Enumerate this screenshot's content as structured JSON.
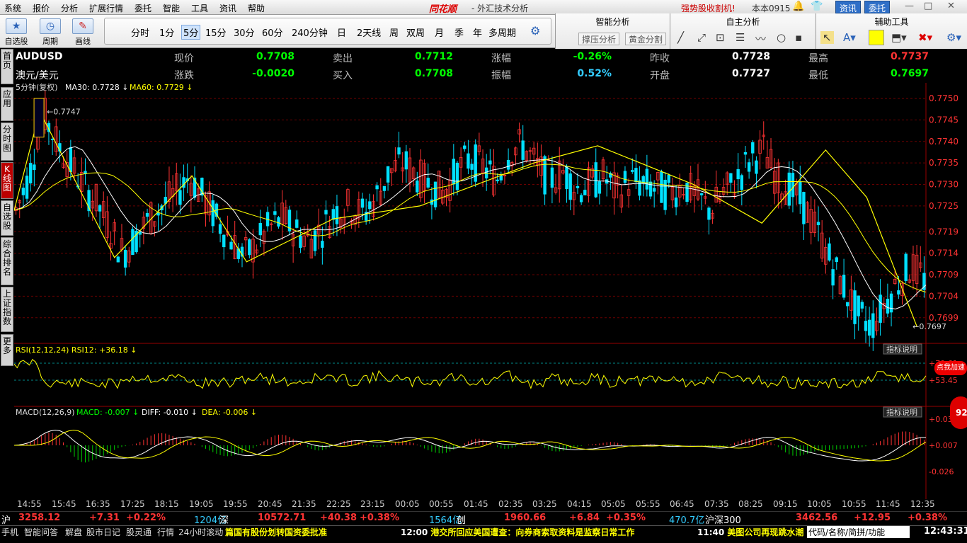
{
  "menu": {
    "items": [
      "系统",
      "报价",
      "分析",
      "扩展行情",
      "委托",
      "智能",
      "工具",
      "资讯",
      "帮助"
    ],
    "brand": "同花顺",
    "subtitle": "- 外汇技术分析",
    "promo": "强势股收割机!",
    "version": "本本0915",
    "btn_news": "资讯",
    "btn_trade": "委托",
    "win_min": "—",
    "win_max": "□",
    "win_close": "✕"
  },
  "toolbar": {
    "select_stock": "自选股",
    "period": "周期",
    "draw": "画线",
    "periods": [
      "分时",
      "1分",
      "5分",
      "15分",
      "30分",
      "60分",
      "240分钟",
      "日",
      "2天线",
      "周",
      "双周",
      "月",
      "季",
      "年",
      "多周期"
    ],
    "selected_period": "5分",
    "smart": {
      "title": "智能分析",
      "btn1": "撑压分析",
      "btn2": "黄金分割"
    },
    "custom": {
      "title": "自主分析"
    },
    "aux": {
      "title": "辅助工具"
    }
  },
  "lefttabs": [
    "首页",
    "应用",
    "分时图",
    "K线图",
    "自选股",
    "综合排名",
    "上证指数",
    "更多"
  ],
  "info": {
    "symbol": "AUDUSD",
    "name": "澳元/美元",
    "row1": [
      [
        "现价",
        "0.7708",
        "g"
      ],
      [
        "卖出",
        "0.7712",
        "g"
      ],
      [
        "涨幅",
        "-0.26%",
        "g"
      ],
      [
        "昨收",
        "0.7728",
        "w"
      ],
      [
        "最高",
        "0.7737",
        "r"
      ]
    ],
    "row2": [
      [
        "涨跌",
        "-0.0020",
        "g"
      ],
      [
        "买入",
        "0.7708",
        "g"
      ],
      [
        "振幅",
        "0.52%",
        "c"
      ],
      [
        "开盘",
        "0.7727",
        "w"
      ],
      [
        "最低",
        "0.7697",
        "g"
      ]
    ]
  },
  "chart_data": {
    "type": "candlestick",
    "title": "5分钟(复权)",
    "ma30": "MA30: 0.7728",
    "ma60": "MA60: 0.7729",
    "y_ticks": [
      "0.7750",
      "0.7745",
      "0.7740",
      "0.7735",
      "0.7730",
      "0.7725",
      "0.7719",
      "0.7714",
      "0.7709",
      "0.7704",
      "0.7699"
    ],
    "y_range": [
      0.7696,
      0.7751
    ],
    "high_label": "0.7747",
    "low_label": "0.7697",
    "rsi": {
      "label": "RSI(12,12,24) RSI12: +36.18",
      "ticks": [
        "79.61",
        "53.45"
      ],
      "button": "指标说明"
    },
    "macd": {
      "label": "MACD(12,26,9)",
      "macd": "MACD: -0.007",
      "diff": "DIFF: -0.010",
      "dea": "DEA: -0.006",
      "ticks": [
        "0.038",
        "0.007",
        "-0.026"
      ],
      "button": "指标说明"
    },
    "x_ticks": [
      "14:55",
      "15:45",
      "16:35",
      "17:25",
      "18:15",
      "19:05",
      "19:55",
      "20:45",
      "21:35",
      "22:25",
      "23:15",
      "00:05",
      "00:55",
      "01:45",
      "02:35",
      "03:25",
      "04:15",
      "05:05",
      "05:55",
      "06:45",
      "07:35",
      "08:25",
      "09:15",
      "10:05",
      "10:55",
      "11:45",
      "12:35"
    ],
    "close_path": [
      0.7724,
      0.7732,
      0.7747,
      0.774,
      0.7735,
      0.773,
      0.7726,
      0.772,
      0.7714,
      0.7718,
      0.7722,
      0.7725,
      0.7728,
      0.7732,
      0.7727,
      0.7722,
      0.7718,
      0.7713,
      0.7716,
      0.772,
      0.7722,
      0.7719,
      0.7717,
      0.772,
      0.7724,
      0.7725,
      0.7723,
      0.7727,
      0.7733,
      0.7735,
      0.7732,
      0.773,
      0.7728,
      0.7733,
      0.7736,
      0.7734,
      0.7731,
      0.7738,
      0.7739,
      0.7734,
      0.7731,
      0.7733,
      0.7729,
      0.773,
      0.7732,
      0.7728,
      0.7731,
      0.773,
      0.7729,
      0.7728,
      0.773,
      0.7727,
      0.7724,
      0.7728,
      0.7731,
      0.7736,
      0.7738,
      0.7731,
      0.7729,
      0.7725,
      0.7719,
      0.7712,
      0.7706,
      0.77,
      0.7697,
      0.7702,
      0.7707,
      0.7711,
      0.7708
    ],
    "zigzag": [
      [
        0.0,
        0.7724
      ],
      [
        0.028,
        0.7747
      ],
      [
        0.11,
        0.7713
      ],
      [
        0.195,
        0.7732
      ],
      [
        0.255,
        0.7712
      ],
      [
        0.35,
        0.7722
      ],
      [
        0.445,
        0.7725
      ],
      [
        0.57,
        0.7735
      ],
      [
        0.64,
        0.7739
      ],
      [
        0.745,
        0.773
      ],
      [
        0.82,
        0.7721
      ],
      [
        0.89,
        0.7738
      ],
      [
        0.935,
        0.7727
      ],
      [
        0.99,
        0.7697
      ]
    ]
  },
  "indexbar": [
    [
      "沪",
      "w"
    ],
    [
      "3258.12",
      "r"
    ],
    [
      "+7.31",
      "r"
    ],
    [
      "+0.22%",
      "r"
    ],
    [
      "1204亿",
      "c"
    ],
    [
      "深",
      "w"
    ],
    [
      "10572.71",
      "r"
    ],
    [
      "+40.38",
      "r"
    ],
    [
      "+0.38%",
      "r"
    ],
    [
      "1564亿",
      "c"
    ],
    [
      "创",
      "w"
    ],
    [
      "1960.66",
      "r"
    ],
    [
      "+6.84",
      "r"
    ],
    [
      "+0.35%",
      "r"
    ],
    [
      "470.7亿",
      "c"
    ],
    [
      "沪深300",
      "w"
    ],
    [
      "3462.56",
      "r"
    ],
    [
      "+12.95",
      "r"
    ],
    [
      "+0.38%",
      "r"
    ]
  ],
  "statusbar": {
    "tabs": [
      "手机",
      "智能问答",
      "解盘",
      "股市日记",
      "股灵通",
      "行情",
      "24小时滚动"
    ],
    "news1": "篇国有股份划转国资委批准",
    "news2_time": "12:00",
    "news2": "港交所回应美国遭查：向券商索取资料是监察日常工作",
    "news3_time": "11:40",
    "news3": "美图公司再现跳水潮",
    "search": "代码/名称/简拼/功能",
    "clock": "12:43:31"
  },
  "widgets": {
    "bubble": "点我加速",
    "orb": "92"
  },
  "colors": {
    "up": "#ff3333",
    "down": "#00e0ff",
    "ma1": "#ffffff",
    "ma2": "#ffff00",
    "grid": "#6a0000"
  }
}
